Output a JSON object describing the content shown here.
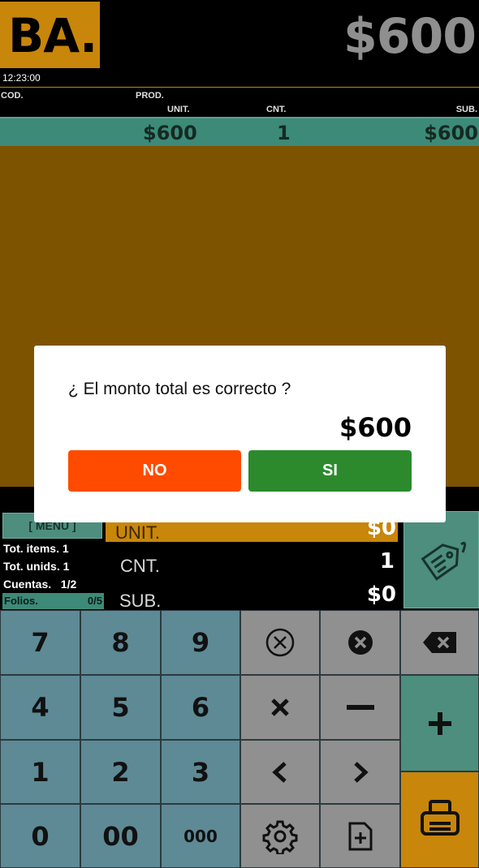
{
  "header": {
    "logo": "BA.",
    "total": "$600",
    "clock": "12:23:00"
  },
  "columns": {
    "cod": "COD.",
    "prod": "PROD.",
    "unit": "UNIT.",
    "cnt": "CNT.",
    "sub": "SUB."
  },
  "selected_row": {
    "unit": "$600",
    "cnt": "1",
    "sub": "$600"
  },
  "status": {
    "menu_label": "[ MENU ]",
    "tot_items": "Tot. items. 1",
    "tot_unids": "Tot. unids. 1",
    "cuentas": "Cuentas.   1/2",
    "folios_label": "Folios.",
    "folios_value": "0/5"
  },
  "entry": {
    "unit_label": "UNIT.",
    "unit_value": "$0",
    "cnt_label": "CNT.",
    "cnt_value": "1",
    "sub_label": "SUB.",
    "sub_value": "$0"
  },
  "keypad": {
    "k7": "7",
    "k8": "8",
    "k9": "9",
    "k4": "4",
    "k5": "5",
    "k6": "6",
    "k1": "1",
    "k2": "2",
    "k3": "3",
    "k0": "0",
    "k00": "00",
    "k000": "000"
  },
  "dialog": {
    "question": "¿ El monto total es correcto ?",
    "amount": "$600",
    "no_label": "NO",
    "si_label": "SI"
  },
  "colors": {
    "accent": "#c8860a",
    "teal": "#4d8e7e",
    "keypad_num": "#5e8a95",
    "no_button": "#ff4b00",
    "si_button": "#2c8a2c"
  },
  "icons": [
    "tag-icon",
    "clear-circle-icon",
    "clear-circle-filled-icon",
    "backspace-icon",
    "multiply-icon",
    "minus-icon",
    "plus-icon",
    "chevron-left-icon",
    "chevron-right-icon",
    "settings-icon",
    "add-document-icon",
    "print-icon"
  ]
}
